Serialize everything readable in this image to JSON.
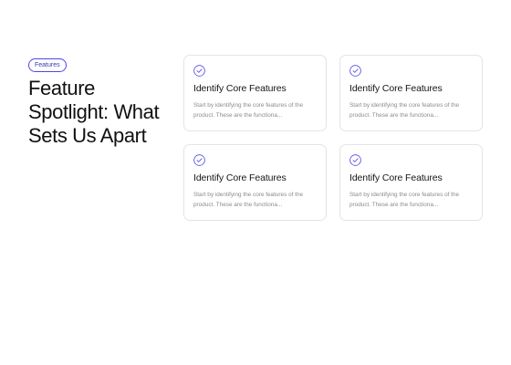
{
  "hero": {
    "badge": "Features",
    "title": "Feature Spotlight: What Sets Us Apart"
  },
  "features": [
    {
      "icon": "check-circle-icon",
      "title": "Identify Core Features",
      "description": "Start by identifying the core features of the product. These are the functiona..."
    },
    {
      "icon": "check-circle-icon",
      "title": "Identify Core Features",
      "description": "Start by identifying the core features of the product. These are the functiona..."
    },
    {
      "icon": "check-circle-icon",
      "title": "Identify Core Features",
      "description": "Start by identifying the core features of the product. These are the functiona..."
    },
    {
      "icon": "check-circle-icon",
      "title": "Identify Core Features",
      "description": "Start by identifying the core features of the product. These are the functiona..."
    }
  ],
  "colors": {
    "accent": "#4f46e5",
    "card_border": "#e4e4e7",
    "muted_text": "#8b8b8b"
  }
}
